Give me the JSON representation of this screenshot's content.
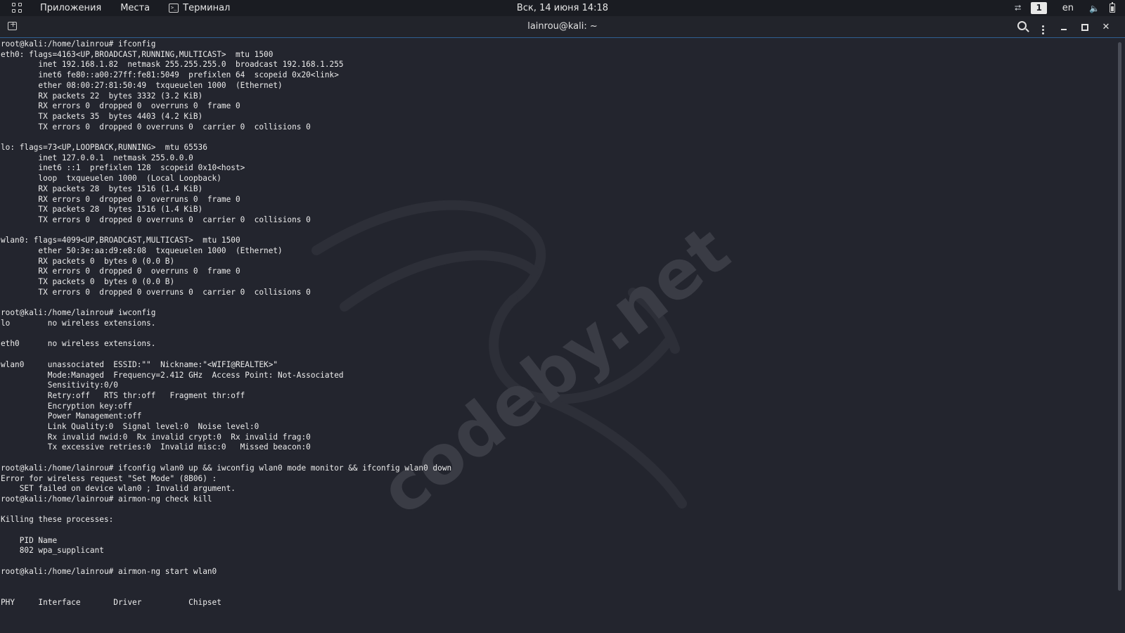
{
  "topbar": {
    "menu": [
      "Приложения",
      "Места"
    ],
    "terminal_menu": "Терминал",
    "clock": "Вск, 14 июня  14:18",
    "workspace": "1",
    "lang": "en"
  },
  "window": {
    "title": "lainrou@kali: ~"
  },
  "watermark": "codeby.net",
  "terminal": {
    "lines": [
      "root@kali:/home/lainrou# ifconfig",
      "eth0: flags=4163<UP,BROADCAST,RUNNING,MULTICAST>  mtu 1500",
      "        inet 192.168.1.82  netmask 255.255.255.0  broadcast 192.168.1.255",
      "        inet6 fe80::a00:27ff:fe81:5049  prefixlen 64  scopeid 0x20<link>",
      "        ether 08:00:27:81:50:49  txqueuelen 1000  (Ethernet)",
      "        RX packets 22  bytes 3332 (3.2 KiB)",
      "        RX errors 0  dropped 0  overruns 0  frame 0",
      "        TX packets 35  bytes 4403 (4.2 KiB)",
      "        TX errors 0  dropped 0 overruns 0  carrier 0  collisions 0",
      "",
      "lo: flags=73<UP,LOOPBACK,RUNNING>  mtu 65536",
      "        inet 127.0.0.1  netmask 255.0.0.0",
      "        inet6 ::1  prefixlen 128  scopeid 0x10<host>",
      "        loop  txqueuelen 1000  (Local Loopback)",
      "        RX packets 28  bytes 1516 (1.4 KiB)",
      "        RX errors 0  dropped 0  overruns 0  frame 0",
      "        TX packets 28  bytes 1516 (1.4 KiB)",
      "        TX errors 0  dropped 0 overruns 0  carrier 0  collisions 0",
      "",
      "wlan0: flags=4099<UP,BROADCAST,MULTICAST>  mtu 1500",
      "        ether 50:3e:aa:d9:e8:08  txqueuelen 1000  (Ethernet)",
      "        RX packets 0  bytes 0 (0.0 B)",
      "        RX errors 0  dropped 0  overruns 0  frame 0",
      "        TX packets 0  bytes 0 (0.0 B)",
      "        TX errors 0  dropped 0 overruns 0  carrier 0  collisions 0",
      "",
      "root@kali:/home/lainrou# iwconfig",
      "lo        no wireless extensions.",
      "",
      "eth0      no wireless extensions.",
      "",
      "wlan0     unassociated  ESSID:\"\"  Nickname:\"<WIFI@REALTEK>\"",
      "          Mode:Managed  Frequency=2.412 GHz  Access Point: Not-Associated",
      "          Sensitivity:0/0",
      "          Retry:off   RTS thr:off   Fragment thr:off",
      "          Encryption key:off",
      "          Power Management:off",
      "          Link Quality:0  Signal level:0  Noise level:0",
      "          Rx invalid nwid:0  Rx invalid crypt:0  Rx invalid frag:0",
      "          Tx excessive retries:0  Invalid misc:0   Missed beacon:0",
      "",
      "root@kali:/home/lainrou# ifconfig wlan0 up && iwconfig wlan0 mode monitor && ifconfig wlan0 down",
      "Error for wireless request \"Set Mode\" (8B06) :",
      "    SET failed on device wlan0 ; Invalid argument.",
      "root@kali:/home/lainrou# airmon-ng check kill",
      "",
      "Killing these processes:",
      "",
      "    PID Name",
      "    802 wpa_supplicant",
      "",
      "root@kali:/home/lainrou# airmon-ng start wlan0",
      "",
      "",
      "PHY     Interface       Driver          Chipset"
    ]
  }
}
